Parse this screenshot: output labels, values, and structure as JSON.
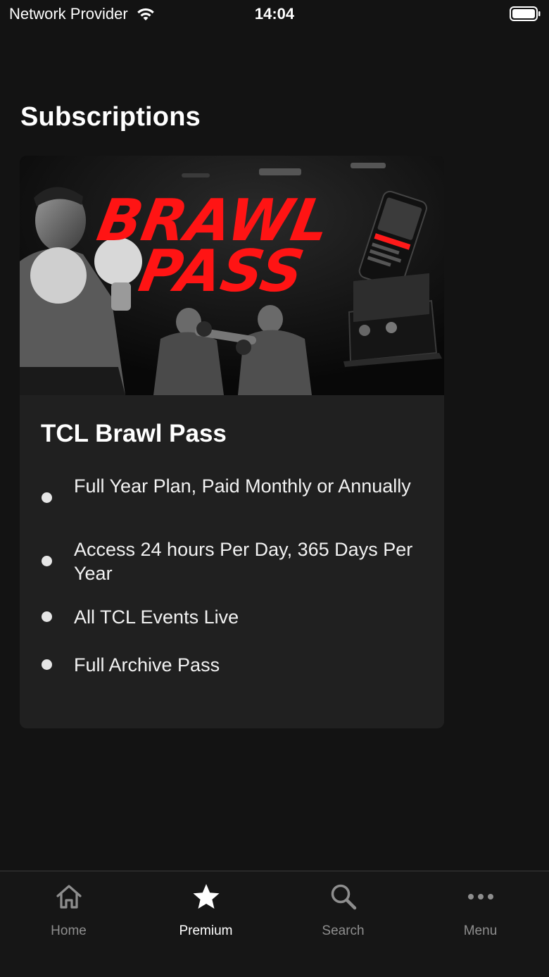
{
  "status_bar": {
    "carrier": "Network Provider",
    "time": "14:04"
  },
  "page": {
    "title": "Subscriptions"
  },
  "card": {
    "banner_text_line1": "BRAWL",
    "banner_text_line2": "PASS",
    "plan_title": "TCL Brawl Pass",
    "features": [
      "Full Year Plan, Paid Monthly or Annually",
      "Access 24 hours Per Day, 365 Days Per Year",
      "All TCL Events Live",
      "Full Archive Pass"
    ]
  },
  "tab_bar": {
    "active": "Premium",
    "items": [
      {
        "label": "Home",
        "icon": "home-icon"
      },
      {
        "label": "Premium",
        "icon": "star-icon"
      },
      {
        "label": "Search",
        "icon": "search-icon"
      },
      {
        "label": "Menu",
        "icon": "more-icon"
      }
    ]
  },
  "colors": {
    "background": "#131313",
    "card": "#202020",
    "banner_red": "#ff1a1a",
    "tab_inactive": "#8e8e8e"
  }
}
